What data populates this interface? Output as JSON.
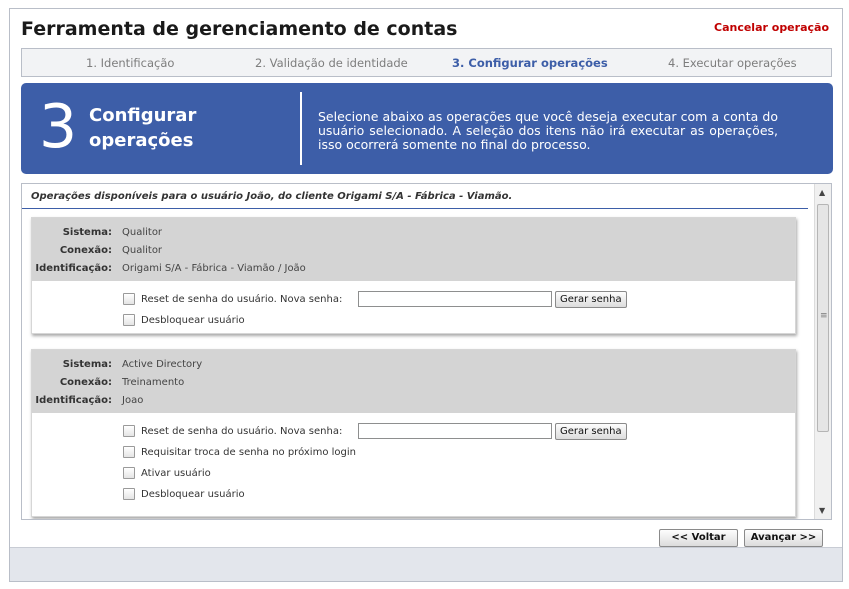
{
  "header": {
    "title": "Ferramenta de gerenciamento de contas",
    "cancel_label": "Cancelar operação"
  },
  "steps": [
    {
      "label": "1. Identificação",
      "active": false
    },
    {
      "label": "2. Validação de identidade",
      "active": false
    },
    {
      "label": "3. Configurar operações",
      "active": true
    },
    {
      "label": "4. Executar operações",
      "active": false
    }
  ],
  "banner": {
    "number": "3",
    "title": "Configurar operações",
    "description": "Selecione abaixo as operações que você deseja executar com a conta do usuário selecionado. A seleção dos itens não irá executar as operações, isso ocorrerá somente no final do processo."
  },
  "operations": {
    "header": "Operações disponíveis para o usuário João, do cliente Origami S/A - Fábrica - Viamão.",
    "cards": [
      {
        "info": [
          {
            "key": "Sistema:",
            "value": "Qualitor"
          },
          {
            "key": "Conexão:",
            "value": "Qualitor"
          },
          {
            "key": "Identificação:",
            "value": "Origami S/A - Fábrica - Viamão / João"
          }
        ],
        "reset_label": "Reset de senha do usuário. Nova senha:",
        "password_value": "",
        "generate_label": "Gerar senha",
        "options": [
          "Desbloquear usuário"
        ]
      },
      {
        "info": [
          {
            "key": "Sistema:",
            "value": "Active Directory"
          },
          {
            "key": "Conexão:",
            "value": "Treinamento"
          },
          {
            "key": "Identificação:",
            "value": "Joao"
          }
        ],
        "reset_label": "Reset de senha do usuário. Nova senha:",
        "password_value": "",
        "generate_label": "Gerar senha",
        "options": [
          "Requisitar troca de senha no próximo login",
          "Ativar usuário",
          "Desbloquear usuário"
        ]
      }
    ]
  },
  "nav": {
    "back_label": "<< Voltar",
    "next_label": "Avançar >>"
  },
  "colors": {
    "accent": "#3d5ea8",
    "cancel": "#c00000",
    "card_header": "#d4d4d4"
  }
}
